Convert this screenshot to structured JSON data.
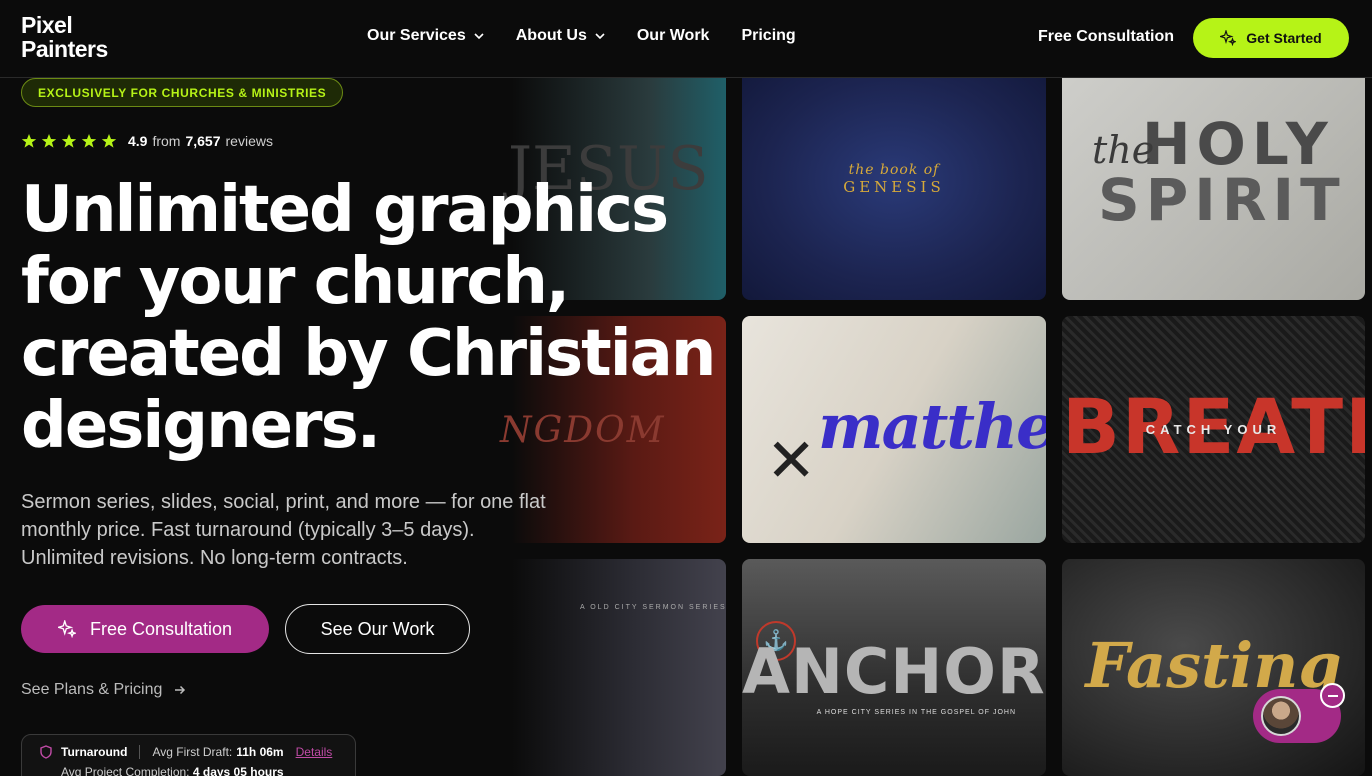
{
  "logo": {
    "line1": "Pixel",
    "line2": "Painters"
  },
  "nav": {
    "items": [
      {
        "label": "Our Services",
        "dropdown": true
      },
      {
        "label": "About Us",
        "dropdown": true
      },
      {
        "label": "Our Work",
        "dropdown": false
      },
      {
        "label": "Pricing",
        "dropdown": false
      }
    ],
    "free_consultation": "Free Consultation",
    "get_started": "Get Started"
  },
  "hero": {
    "badge": "EXCLUSIVELY FOR CHURCHES & MINISTRIES",
    "rating": {
      "score": "4.9",
      "from": "from",
      "count": "7,657",
      "reviews": "reviews",
      "stars": 5
    },
    "headline": [
      "Unlimited graphics",
      "for your church,",
      "created by Christian",
      "designers."
    ],
    "subtitle": [
      "Sermon series, slides, social, print, and more — for one flat",
      "monthly price. Fast turnaround (typically 3–5 days).",
      "Unlimited revisions. No long-term contracts."
    ],
    "cta_primary": "Free Consultation",
    "cta_secondary": "See Our Work",
    "plans_link": "See Plans & Pricing"
  },
  "stats": {
    "turnaround": "Turnaround",
    "first_draft_label": "Avg First Draft:",
    "first_draft_value": "11h 06m",
    "details": "Details",
    "completion_label": "Avg Project Completion:",
    "completion_value": "4 days 05 hours"
  },
  "gallery": {
    "genesis": {
      "small": "the book of",
      "big": "GENESIS"
    },
    "holy": {
      "the": "the",
      "line1": "HOLY",
      "line2": "SPIRIT"
    },
    "matthew": {
      "word": "matthew"
    },
    "breath": {
      "big": "BREATH",
      "small": "CATCH YOUR"
    },
    "anchored": {
      "word": "ANCHORED",
      "sub": "A HOPE CITY SERIES IN THE GOSPEL OF JOHN"
    },
    "fasting": {
      "word": "Fasting"
    },
    "ghost": {
      "jesus": "JESUS",
      "kingdom": "NGDOM",
      "series": "A OLD CITY SERMON SERIES"
    }
  },
  "colors": {
    "accent_lime": "#b6f317",
    "accent_magenta": "#a32a86",
    "background": "#0b0b0b"
  }
}
